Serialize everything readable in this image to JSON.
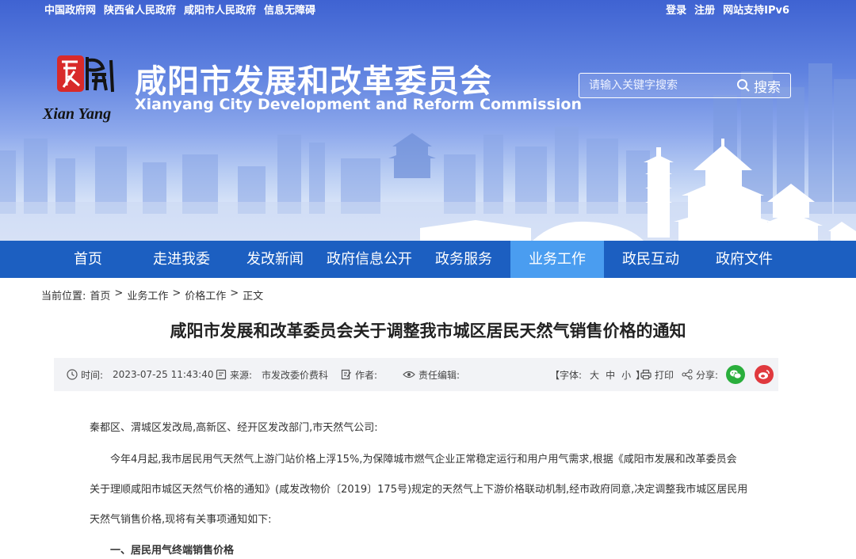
{
  "top_links": [
    "中国政府网",
    "陕西省人民政府",
    "咸阳市人民政府",
    "信息无障碍"
  ],
  "user_links": [
    "登录",
    "注册",
    "网站支持IPv6"
  ],
  "site": {
    "logo_text": "Xian Yang",
    "title": "咸阳市发展和改革委员会",
    "subtitle": "Xianyang City Development and Reform Commission"
  },
  "search": {
    "placeholder": "请输入关键字搜索",
    "button_label": "搜索"
  },
  "nav": {
    "items": [
      "首页",
      "走进我委",
      "发改新闻",
      "政府信息公开",
      "政务服务",
      "业务工作",
      "政民互动",
      "政府文件"
    ],
    "active": "业务工作"
  },
  "breadcrumb": {
    "label": "当前位置:",
    "items": [
      "首页",
      "业务工作",
      "价格工作",
      "正文"
    ],
    "separator": ">"
  },
  "article": {
    "title": "咸阳市发展和改革委员会关于调整我市城区居民天然气销售价格的通知",
    "meta": {
      "time_label": "时间:",
      "time_value": "2023-07-25 11:43:40",
      "source_label": "来源:",
      "source_value": "市发改委价费科",
      "author_label": "作者:",
      "editor_label": "责任编辑:",
      "font_label": "【字体:",
      "font_sizes": [
        "大",
        "中",
        "小"
      ],
      "font_close": "】",
      "print_label": "打印",
      "share_label": "分享:",
      "wechat_color": "#2aae3c",
      "weibo_color": "#e0393e"
    },
    "paragraphs": [
      "秦都区、渭城区发改局,高新区、经开区发改部门,市天然气公司:",
      "今年4月起,我市居民用气天然气上游门站价格上浮15%,为保障城市燃气企业正常稳定运行和用户用气需求,根据《咸阳市发展和改革委员会",
      "关于理顺咸阳市城区天然气价格的通知》(咸发改物价〔2019〕175号)规定的天然气上下游价格联动机制,经市政府同意,决定调整我市城区居民用",
      "天然气销售价格,现将有关事项通知如下:",
      "一、居民用气终端销售价格"
    ]
  },
  "colors": {
    "nav_bg": "#1c5fc1",
    "nav_active": "#4a9df0",
    "meta_bg": "#f2f3f6"
  }
}
